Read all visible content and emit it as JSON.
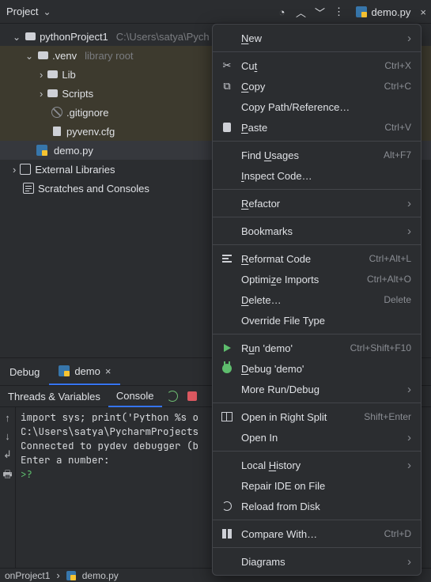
{
  "header": {
    "title": "Project"
  },
  "topbar": {
    "file_tab": "demo.py"
  },
  "tree": {
    "root": "pythonProject1",
    "root_path": "C:\\Users\\satya\\Pych",
    "venv": ".venv",
    "venv_hint": "library root",
    "lib": "Lib",
    "scripts": "Scripts",
    "gitignore": ".gitignore",
    "pyvenv": "pyvenv.cfg",
    "demo": "demo.py",
    "ext": "External Libraries",
    "scratch": "Scratches and Consoles"
  },
  "debug": {
    "label": "Debug",
    "tab": "demo",
    "threads": "Threads & Variables",
    "console": "Console",
    "lines": [
      "import sys; print('Python %s o",
      "C:\\Users\\satya\\PycharmProjects",
      "Connected to pydev debugger (b",
      "Enter a number:",
      ">?"
    ]
  },
  "crumbs": {
    "a": "onProject1",
    "b": "demo.py"
  },
  "menu": {
    "new": "New",
    "cut": "Cut",
    "cut_sc": "Ctrl+X",
    "copy": "Copy",
    "copy_sc": "Ctrl+C",
    "copypath": "Copy Path/Reference…",
    "paste": "Paste",
    "paste_sc": "Ctrl+V",
    "findusages": "Find Usages",
    "findusages_sc": "Alt+F7",
    "inspect": "Inspect Code…",
    "refactor": "Refactor",
    "bookmarks": "Bookmarks",
    "reformat": "Reformat Code",
    "reformat_sc": "Ctrl+Alt+L",
    "optimize": "Optimize Imports",
    "optimize_sc": "Ctrl+Alt+O",
    "delete": "Delete…",
    "delete_sc": "Delete",
    "override": "Override File Type",
    "run": "Run 'demo'",
    "run_sc": "Ctrl+Shift+F10",
    "debug": "Debug 'demo'",
    "morerun": "More Run/Debug",
    "openright": "Open in Right Split",
    "openright_sc": "Shift+Enter",
    "openin": "Open In",
    "history": "Local History",
    "repair": "Repair IDE on File",
    "reload": "Reload from Disk",
    "compare": "Compare With…",
    "compare_sc": "Ctrl+D",
    "diagrams": "Diagrams"
  }
}
